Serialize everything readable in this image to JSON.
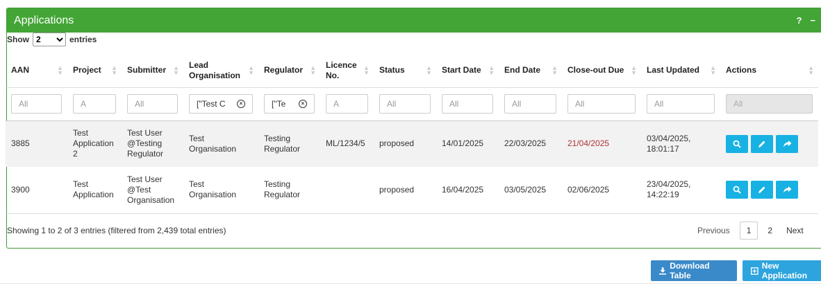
{
  "panel": {
    "title": "Applications",
    "help": "?",
    "collapse": "−"
  },
  "length": {
    "show": "Show",
    "selected": "2",
    "entries": "entries"
  },
  "columns": [
    "AAN",
    "Project",
    "Submitter",
    "Lead Organisation",
    "Regulator",
    "Licence No.",
    "Status",
    "Start Date",
    "End Date",
    "Close-out Due",
    "Last Updated",
    "Actions"
  ],
  "filters": [
    "All",
    "A",
    "All",
    "[\"Test C",
    "[\"Te",
    "A",
    "All",
    "All",
    "All",
    "All",
    "All",
    "All"
  ],
  "rows": [
    {
      "aan": "3885",
      "project": "Test Application 2",
      "submitter": "Test User @Testing Regulator",
      "lead": "Test Organisation",
      "regulator": "Testing Regulator",
      "licence": "ML/1234/5",
      "status": "proposed",
      "start": "14/01/2025",
      "end": "22/03/2025",
      "closeout": "21/04/2025",
      "updated": "03/04/2025, 18:01:17"
    },
    {
      "aan": "3900",
      "project": "Test Application",
      "submitter": "Test User @Test Organisation",
      "lead": "Test Organisation",
      "regulator": "Testing Regulator",
      "licence": "",
      "status": "proposed",
      "start": "16/04/2025",
      "end": "03/05/2025",
      "closeout": "02/06/2025",
      "updated": "23/04/2025, 14:22:19"
    }
  ],
  "footer": {
    "info": "Showing 1 to 2 of 3 entries (filtered from 2,439 total entries)"
  },
  "pager": {
    "previous": "Previous",
    "page1": "1",
    "page2": "2",
    "next": "Next"
  },
  "buttons": {
    "download": "Download Table",
    "new": "New Application"
  },
  "colors": {
    "header": "#43a536",
    "action": "#17b2e3",
    "overdue": "#b03333"
  }
}
